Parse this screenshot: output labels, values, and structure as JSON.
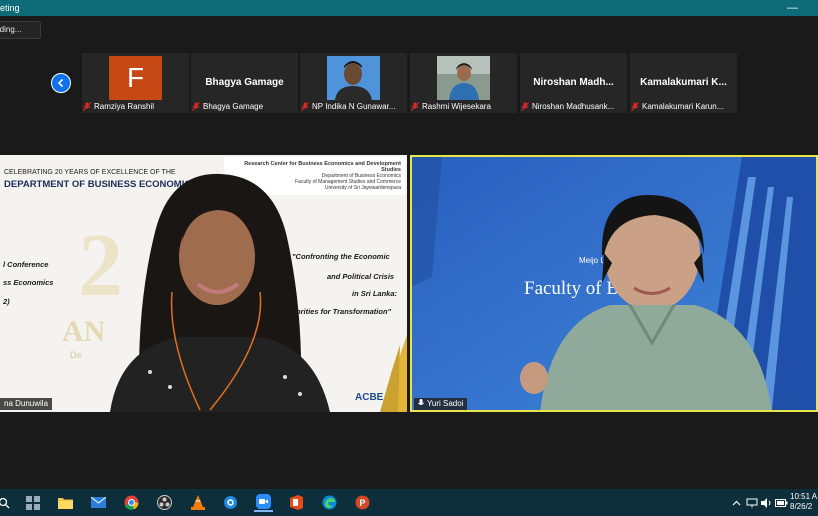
{
  "window": {
    "title": "eting",
    "minimize_glyph": "—"
  },
  "recording": {
    "label": "rding..."
  },
  "strip": {
    "prev_icon": "chevron-left-icon",
    "participants": [
      {
        "label": "Ramziya Ranshil",
        "avatar_letter": "F",
        "muted": true
      },
      {
        "label": "Bhagya Gamage",
        "display": "Bhagya Gamage",
        "muted": true
      },
      {
        "label": "NP Indika N Gunawar...",
        "muted": true
      },
      {
        "label": "Rashmi Wijesekara",
        "muted": true
      },
      {
        "label": "Niroshan Madhusank...",
        "display": "Niroshan  Madh...",
        "muted": true
      },
      {
        "label": "Kamalakumari Karun...",
        "display": "Kamalakumari  K...",
        "muted": true
      }
    ]
  },
  "left_video": {
    "name_label": "na Dunuwila",
    "slide": {
      "banner_title": "Research Center for Business Economics and Development Studies",
      "banner_line1": "Department of Business Economics",
      "banner_line2": "Faculty of Management Studies and Commerce",
      "banner_line3": "University of Sri Jayewardenepura",
      "celebrating": "CELEBRATING 20 YEARS OF EXCELLENCE OF THE",
      "department": "DEPARTMENT OF BUSINESS ECONOMICS",
      "left_l1": "l Conference",
      "left_l2": "ss Economics",
      "left_l3": "2)",
      "theme_l1": "\"Confronting  the Economic",
      "theme_l2": "and Political Crisis",
      "theme_l3": "in Sri Lanka:",
      "theme_l4": "Priorities for Transformation\"",
      "logo_text": "ACBE",
      "watermark": "AN",
      "sub_watermark": "De"
    }
  },
  "right_video": {
    "name_label": "Yuri Sadoi",
    "meijo": "Meijo U",
    "faculty": "Faculty of B",
    "faculty_tail": "s",
    "active_speaker_color": "#e6e64c"
  },
  "taskbar": {
    "apps": [
      "start-icon",
      "file-explorer-icon",
      "mail-icon",
      "chrome-icon",
      "obs-icon",
      "vlc-icon",
      "settings-icon",
      "zoom-icon",
      "office-icon",
      "edge-icon",
      "powerpoint-icon"
    ],
    "clock_time": "10:51 A",
    "clock_date": "8/26/2"
  }
}
